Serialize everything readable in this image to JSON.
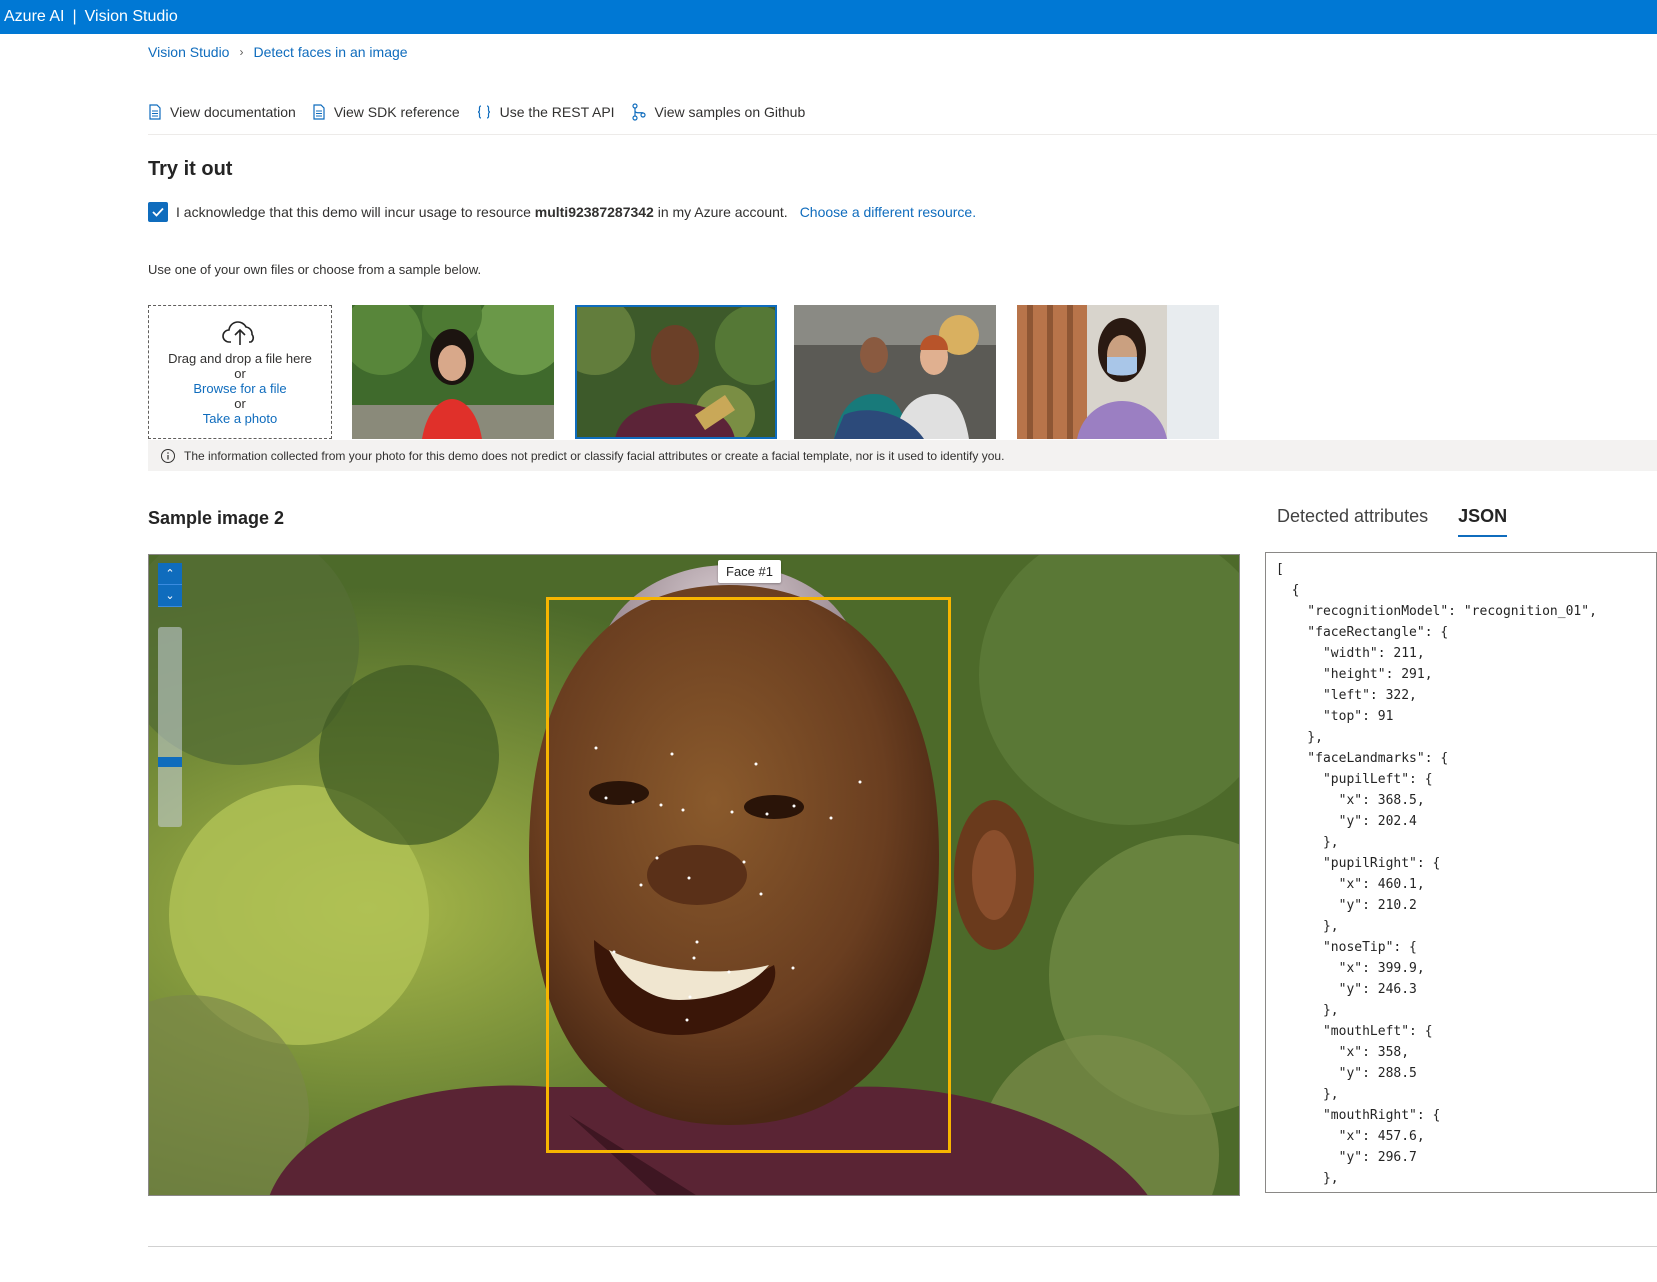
{
  "topbar": {
    "brand": "Azure AI",
    "separator": "|",
    "product": "Vision Studio"
  },
  "breadcrumb": {
    "root": "Vision Studio",
    "current": "Detect faces in an image"
  },
  "toolbar": {
    "view_documentation": "View documentation",
    "view_sdk_reference": "View SDK reference",
    "use_rest_api": "Use the REST API",
    "view_samples": "View samples on Github"
  },
  "try_it_out": {
    "title": "Try it out",
    "ack_prefix": "I acknowledge that this demo will incur usage to resource",
    "resource": "multi92387287342",
    "ack_suffix": "in my Azure account.",
    "choose_link": "Choose a different resource.",
    "checked": true
  },
  "upload": {
    "hint": "Use one of your own files or choose from a sample below.",
    "drag_text": "Drag and drop a file here",
    "or1": "or",
    "browse": "Browse for a file",
    "or2": "or",
    "take_photo": "Take a photo"
  },
  "notice": "The information collected from your photo for this demo does not predict or classify facial attributes or create a facial template, nor is it used to identify you.",
  "sample": {
    "title": "Sample image 2",
    "face_label": "Face #1"
  },
  "tabs": {
    "detected": "Detected attributes",
    "json": "JSON",
    "active": "JSON"
  },
  "json_text": "[\n  {\n    \"recognitionModel\": \"recognition_01\",\n    \"faceRectangle\": {\n      \"width\": 211,\n      \"height\": 291,\n      \"left\": 322,\n      \"top\": 91\n    },\n    \"faceLandmarks\": {\n      \"pupilLeft\": {\n        \"x\": 368.5,\n        \"y\": 202.4\n      },\n      \"pupilRight\": {\n        \"x\": 460.1,\n        \"y\": 210.2\n      },\n      \"noseTip\": {\n        \"x\": 399.9,\n        \"y\": 246.3\n      },\n      \"mouthLeft\": {\n        \"x\": 358,\n        \"y\": 288.5\n      },\n      \"mouthRight\": {\n        \"x\": 457.6,\n        \"y\": 296.7\n      },",
  "colors": {
    "accent": "#0078d4",
    "link": "#0f6cbd",
    "face_box": "#f7b500"
  },
  "icons": [
    "document-icon",
    "code-braces-icon",
    "github-branch-icon",
    "upload-cloud-icon",
    "info-icon",
    "checkmark-icon"
  ]
}
